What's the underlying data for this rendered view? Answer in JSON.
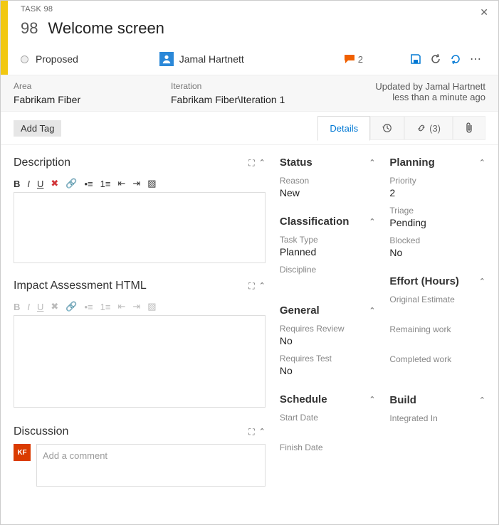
{
  "header": {
    "task_label": "TASK 98",
    "id": "98",
    "title": "Welcome screen",
    "state": "Proposed",
    "assignee": "Jamal Hartnett",
    "comment_count": "2"
  },
  "info": {
    "area_label": "Area",
    "area_value": "Fabrikam Fiber",
    "iteration_label": "Iteration",
    "iteration_value": "Fabrikam Fiber\\Iteration 1",
    "updated_by": "Updated by Jamal Hartnett",
    "updated_when": "less than a minute ago"
  },
  "tags": {
    "add_label": "Add Tag"
  },
  "tabs": {
    "details": "Details",
    "links_count": "(3)"
  },
  "left": {
    "desc_title": "Description",
    "impact_title": "Impact Assessment HTML",
    "discussion_title": "Discussion",
    "comment_placeholder": "Add a comment",
    "avatar_initials": "KF"
  },
  "status": {
    "title": "Status",
    "reason_label": "Reason",
    "reason_value": "New"
  },
  "classification": {
    "title": "Classification",
    "tasktype_label": "Task Type",
    "tasktype_value": "Planned",
    "discipline_label": "Discipline"
  },
  "general": {
    "title": "General",
    "review_label": "Requires Review",
    "review_value": "No",
    "test_label": "Requires Test",
    "test_value": "No"
  },
  "schedule": {
    "title": "Schedule",
    "start_label": "Start Date",
    "finish_label": "Finish Date"
  },
  "planning": {
    "title": "Planning",
    "priority_label": "Priority",
    "priority_value": "2",
    "triage_label": "Triage",
    "triage_value": "Pending",
    "blocked_label": "Blocked",
    "blocked_value": "No"
  },
  "effort": {
    "title": "Effort (Hours)",
    "orig_label": "Original Estimate",
    "remain_label": "Remaining work",
    "completed_label": "Completed work"
  },
  "build": {
    "title": "Build",
    "integrated_label": "Integrated In"
  }
}
